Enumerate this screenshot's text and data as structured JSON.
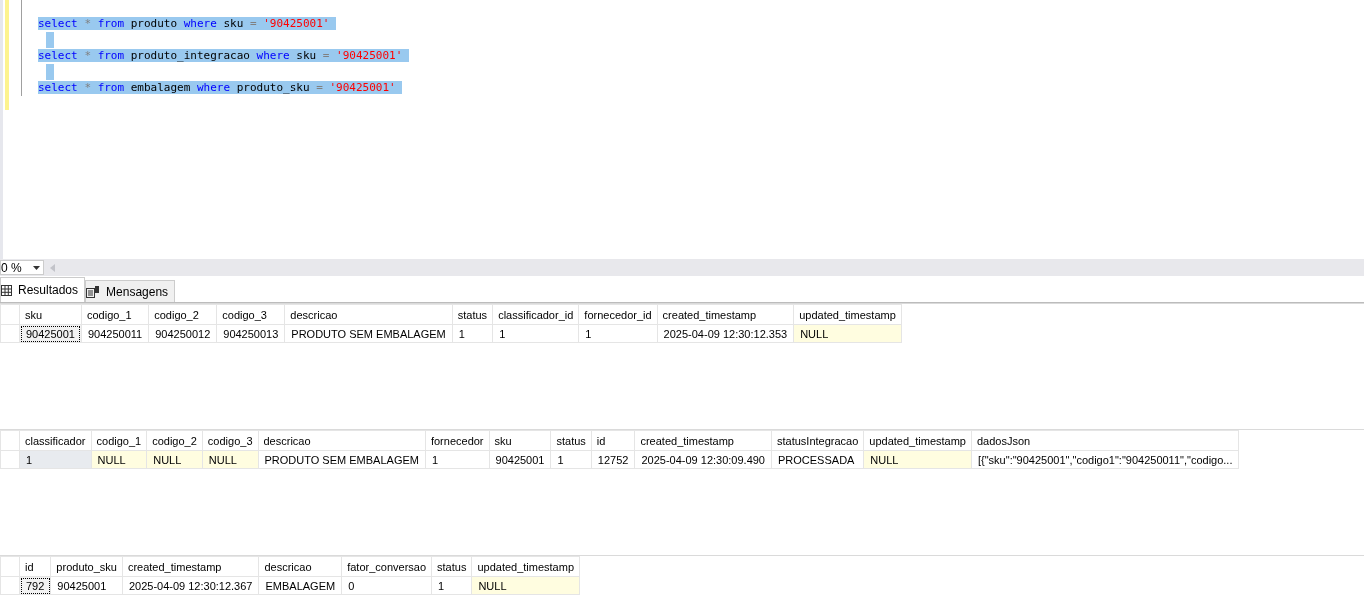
{
  "editor": {
    "lines": [
      {
        "selected": true,
        "tokens": [
          {
            "kind": "keyword",
            "text": "select"
          },
          {
            "kind": "operator",
            "text": "*"
          },
          {
            "kind": "keyword",
            "text": "from"
          },
          {
            "kind": "identifier",
            "text": "produto"
          },
          {
            "kind": "keyword",
            "text": "where"
          },
          {
            "kind": "identifier",
            "text": "sku"
          },
          {
            "kind": "operator",
            "text": "="
          },
          {
            "kind": "string",
            "text": "'90425001'"
          }
        ]
      },
      {
        "selected": true
      },
      {
        "selected": true,
        "tokens": [
          {
            "kind": "keyword",
            "text": "select"
          },
          {
            "kind": "operator",
            "text": "*"
          },
          {
            "kind": "keyword",
            "text": "from"
          },
          {
            "kind": "identifier",
            "text": "produto_integracao"
          },
          {
            "kind": "keyword",
            "text": "where"
          },
          {
            "kind": "identifier",
            "text": "sku"
          },
          {
            "kind": "operator",
            "text": "="
          },
          {
            "kind": "string",
            "text": "'90425001'"
          }
        ]
      },
      {
        "selected": true
      },
      {
        "selected": true,
        "tokens": [
          {
            "kind": "keyword",
            "text": "select"
          },
          {
            "kind": "operator",
            "text": "*"
          },
          {
            "kind": "keyword",
            "text": "from"
          },
          {
            "kind": "identifier",
            "text": "embalagem"
          },
          {
            "kind": "keyword",
            "text": "where"
          },
          {
            "kind": "identifier",
            "text": "produto_sku"
          },
          {
            "kind": "operator",
            "text": "="
          },
          {
            "kind": "string",
            "text": "'90425001'"
          }
        ]
      }
    ]
  },
  "zoom": {
    "value": "0 %"
  },
  "tabs": [
    {
      "label": "Resultados",
      "selected": true,
      "kind": "grid"
    },
    {
      "label": "Mensagens",
      "selected": false,
      "kind": "messages"
    }
  ],
  "grids": [
    {
      "columns": [
        "sku",
        "codigo_1",
        "codigo_2",
        "codigo_3",
        "descricao",
        "status",
        "classificador_id",
        "fornecedor_id",
        "created_timestamp",
        "updated_timestamp"
      ],
      "rows": [
        [
          {
            "text": "90425001",
            "is_null": false,
            "focused": true
          },
          {
            "text": "904250011",
            "is_null": false,
            "focused": false
          },
          {
            "text": "904250012",
            "is_null": false,
            "focused": false
          },
          {
            "text": "904250013",
            "is_null": false,
            "focused": false
          },
          {
            "text": "PRODUTO SEM EMBALAGEM",
            "is_null": false,
            "focused": false
          },
          {
            "text": "1",
            "is_null": false,
            "focused": false
          },
          {
            "text": "1",
            "is_null": false,
            "focused": false
          },
          {
            "text": "1",
            "is_null": false,
            "focused": false
          },
          {
            "text": "2025-04-09 12:30:12.353",
            "is_null": false,
            "focused": false
          },
          {
            "text": "NULL",
            "is_null": true,
            "focused": false
          }
        ]
      ]
    },
    {
      "columns": [
        "classificador",
        "codigo_1",
        "codigo_2",
        "codigo_3",
        "descricao",
        "fornecedor",
        "sku",
        "status",
        "id",
        "created_timestamp",
        "statusIntegracao",
        "updated_timestamp",
        "dadosJson"
      ],
      "rows": [
        [
          {
            "text": "1",
            "is_null": false,
            "focused": true
          },
          {
            "text": "NULL",
            "is_null": true,
            "focused": false
          },
          {
            "text": "NULL",
            "is_null": true,
            "focused": false
          },
          {
            "text": "NULL",
            "is_null": true,
            "focused": false
          },
          {
            "text": "PRODUTO SEM EMBALAGEM",
            "is_null": false,
            "focused": false
          },
          {
            "text": "1",
            "is_null": false,
            "focused": false
          },
          {
            "text": "90425001",
            "is_null": false,
            "focused": false
          },
          {
            "text": "1",
            "is_null": false,
            "focused": false
          },
          {
            "text": "12752",
            "is_null": false,
            "focused": false
          },
          {
            "text": "2025-04-09 12:30:09.490",
            "is_null": false,
            "focused": false
          },
          {
            "text": "PROCESSADA",
            "is_null": false,
            "focused": false
          },
          {
            "text": "NULL",
            "is_null": true,
            "focused": false
          },
          {
            "text": "[{\"sku\":\"90425001\",\"codigo1\":\"904250011\",\"codigo...",
            "is_null": false,
            "focused": false
          }
        ]
      ]
    },
    {
      "columns": [
        "id",
        "produto_sku",
        "created_timestamp",
        "descricao",
        "fator_conversao",
        "status",
        "updated_timestamp"
      ],
      "rows": [
        [
          {
            "text": "792",
            "is_null": false,
            "focused": true
          },
          {
            "text": "90425001",
            "is_null": false,
            "focused": false
          },
          {
            "text": "2025-04-09 12:30:12.367",
            "is_null": false,
            "focused": false
          },
          {
            "text": "EMBALAGEM",
            "is_null": false,
            "focused": false
          },
          {
            "text": "0",
            "is_null": false,
            "focused": false
          },
          {
            "text": "1",
            "is_null": false,
            "focused": false
          },
          {
            "text": "NULL",
            "is_null": true,
            "focused": false
          }
        ]
      ]
    }
  ]
}
